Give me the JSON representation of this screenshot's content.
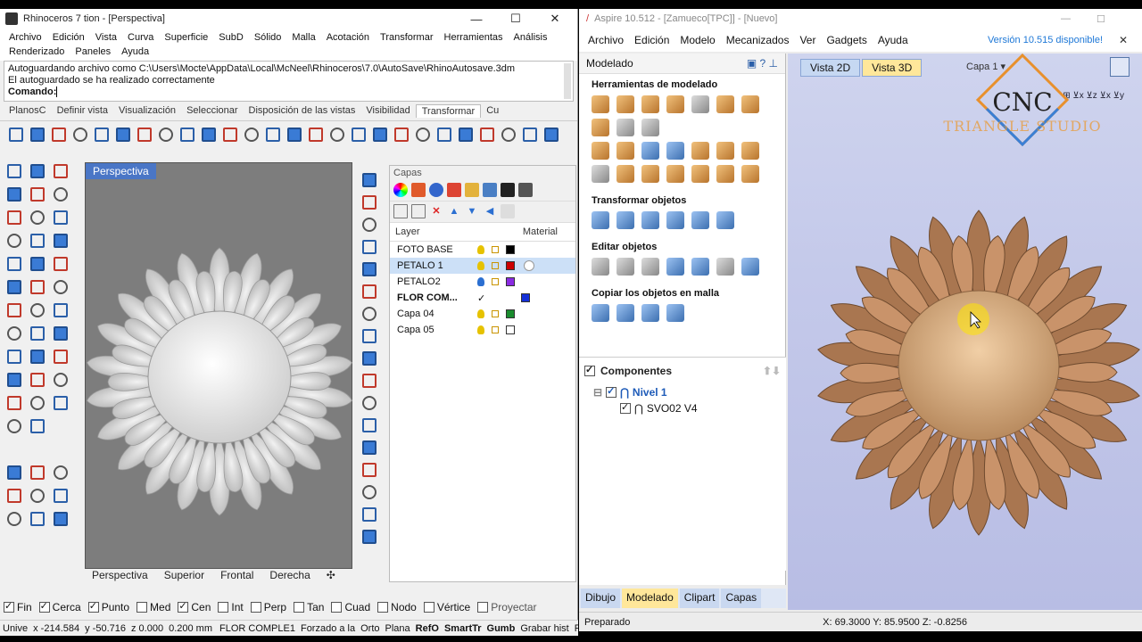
{
  "rhino": {
    "title": "Rhinoceros 7 tion - [Perspectiva]",
    "menu": [
      "Archivo",
      "Edición",
      "Vista",
      "Curva",
      "Superficie",
      "SubD",
      "Sólido",
      "Malla",
      "Acotación",
      "Transformar",
      "Herramientas",
      "Análisis",
      "Renderizado",
      "Paneles",
      "Ayuda"
    ],
    "history": [
      "Autoguardando archivo como C:\\Users\\Mocte\\AppData\\Local\\McNeel\\Rhinoceros\\7.0\\AutoSave\\RhinoAutosave.3dm",
      "El autoguardado se ha realizado correctamente"
    ],
    "command_label": "Comando:",
    "tabs": [
      "PlanosC",
      "Definir vista",
      "Visualización",
      "Seleccionar",
      "Disposición de las vistas",
      "Visibilidad",
      "Transformar",
      "Cu"
    ],
    "active_tab": "Transformar",
    "viewport_title": "Perspectiva",
    "viewport_tabs": [
      "Perspectiva",
      "Superior",
      "Frontal",
      "Derecha"
    ],
    "layers_panel_title": "Capas",
    "layer_columns": {
      "name": "Layer",
      "material": "Material"
    },
    "layers": [
      {
        "name": "FOTO BASE",
        "color": "#000000"
      },
      {
        "name": "PETALO 1",
        "color": "#cc0000",
        "selected": true
      },
      {
        "name": "PETALO2",
        "color": "#8a2be2"
      },
      {
        "name": "FLOR COM...",
        "color": "#1530d8",
        "current": true
      },
      {
        "name": "Capa 04",
        "color": "#1a8c2e"
      },
      {
        "name": "Capa 05",
        "color": "#ffffff"
      }
    ],
    "osnaps": [
      {
        "label": "Fin",
        "on": true
      },
      {
        "label": "Cerca",
        "on": true
      },
      {
        "label": "Punto",
        "on": true
      },
      {
        "label": "Med",
        "on": false
      },
      {
        "label": "Cen",
        "on": true
      },
      {
        "label": "Int",
        "on": false
      },
      {
        "label": "Perp",
        "on": false
      },
      {
        "label": "Tan",
        "on": false
      },
      {
        "label": "Cuad",
        "on": false
      },
      {
        "label": "Nodo",
        "on": false
      },
      {
        "label": "Vértice",
        "on": false
      },
      {
        "label": "Proyectar",
        "on": false
      }
    ],
    "status": [
      "Unive",
      "x -214.584",
      "y -50.716",
      "z 0.000",
      "0.200 mm",
      "FLOR COMPLE1",
      "Forzado a la",
      "Orto",
      "Plana",
      "RefO",
      "SmartTr",
      "Gumb",
      "Grabar hist",
      "Filt"
    ]
  },
  "aspire": {
    "title": "Aspire 10.512 - [Zamueco[TPC]] - [Nuevo]",
    "menu": [
      "Archivo",
      "Edición",
      "Modelo",
      "Mecanizados",
      "Ver",
      "Gadgets",
      "Ayuda"
    ],
    "version_notice": "Versión 10.515 disponible!",
    "pane_title": "Modelado",
    "sections": [
      "Herramientas de modelado",
      "Transformar objetos",
      "Editar objetos",
      "Copiar los objetos en malla"
    ],
    "components_title": "Componentes",
    "tree": {
      "level": "Nivel 1",
      "item": "SVO02 V4"
    },
    "bottom_tabs": [
      "Dibujo",
      "Modelado",
      "Clipart",
      "Capas"
    ],
    "active_bottom_tab": "Modelado",
    "view_tabs": [
      "Vista 2D",
      "Vista 3D"
    ],
    "active_view": "Vista 3D",
    "layer_label": "Capa 1",
    "status_left": "Preparado",
    "status_right": "X: 69.3000 Y: 85.9500 Z: -0.8256",
    "logo_top": "CNC",
    "logo_bottom": "TRIANGLE STUDIO"
  }
}
